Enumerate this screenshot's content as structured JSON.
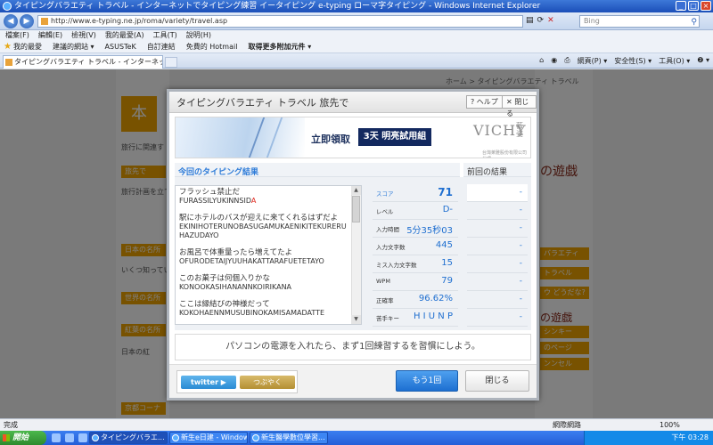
{
  "window": {
    "title": "タイピングバラエティ トラベル - インターネットでタイピング練習 イータイピング e-typing ローマ字タイピング - Windows Internet Explorer",
    "min": "_",
    "max": "□",
    "close": "×"
  },
  "browser": {
    "back": "◀",
    "forward": "▶",
    "url": "http://www.e-typing.ne.jp/roma/variety/travel.asp",
    "search_placeholder": "Bing",
    "menu": [
      "檔案(F)",
      "編輯(E)",
      "檢視(V)",
      "我的最愛(A)",
      "工具(T)",
      "說明(H)"
    ],
    "favorites": [
      "我的最愛",
      "建議的網站 ▾",
      "ASUSTeK",
      "自訂連結",
      "免費的 Hotmail",
      "取得更多附加元件 ▾"
    ],
    "tab_title": "タイピングバラエティ トラベル - インターネッ...",
    "commands": [
      "網頁(P) ▾",
      "安全性(S) ▾",
      "工具(O) ▾",
      "❷ ▾"
    ],
    "status_text": "完成",
    "zone": "網際網路",
    "zoom": "100%"
  },
  "background_page": {
    "breadcrumb": "ホーム > タイピングバラエティ トラベル",
    "logo_glyph": "本",
    "left_lines": [
      "旅行に関連す",
      "旅先で",
      "旅行計画を立て",
      "日本の名所",
      "いくつ知ってい",
      "世界の名所",
      "紅葉の名所",
      "日本の紅",
      "京都コーナー"
    ],
    "right_lines": [
      "の遊戯",
      "バラエティ",
      "トラベル",
      "ウ どうだな?",
      "の遊戯",
      "シンキー",
      "のページ",
      "ンンセル"
    ]
  },
  "modal": {
    "title": "タイピングバラエティ トラベル 旅先で",
    "help_label": "? ヘルプ",
    "close_label": "✕ 閉じる"
  },
  "ad": {
    "cta": "立即領取",
    "trial": "3天 明亮試用組",
    "brand": "VICHY",
    "brand_sub": "薇姿",
    "fine_print": "台灣萊雅股份有限公司代理"
  },
  "results": {
    "header": "今回のタイピング結果",
    "prev_header": "前回の結果",
    "words": [
      {
        "jp": "フラッシュ禁止だ",
        "ro": "FURASSILYUKINNSID",
        "miss": "A"
      },
      {
        "jp": "駅にホテルのバスが迎えに来てくれるはずだよ",
        "ro": "EKINIHOTERUNOBASUGAMUKAENIKITEKURERUHAZUDAYO",
        "miss": ""
      },
      {
        "jp": "お風呂で体重量ったら増えてたよ",
        "ro": "OFURODETAIJYUUHAKATTARAFUETETAYO",
        "miss": ""
      },
      {
        "jp": "このお菓子は何個入りかな",
        "ro": "KONOOKASIHANANNKOIRIKANA",
        "miss": ""
      },
      {
        "jp": "ここは縁結びの神様だって",
        "ro": "KOKOHAENNMUSUBINOKAMISAMADATTE",
        "miss": ""
      }
    ],
    "stats": [
      {
        "label": "スコア",
        "value": "71"
      },
      {
        "label": "レベル",
        "value": "D-"
      },
      {
        "label": "入力時間",
        "value": "5分35秒03"
      },
      {
        "label": "入力文字数",
        "value": "445"
      },
      {
        "label": "ミス入力文字数",
        "value": "15"
      },
      {
        "label": "WPM",
        "value": "79"
      },
      {
        "label": "正確率",
        "value": "96.62%"
      },
      {
        "label": "苦手キー",
        "value": "H I U N P"
      }
    ],
    "prev_values": [
      "-",
      "-",
      "-",
      "-",
      "-",
      "-",
      "-",
      "-"
    ]
  },
  "message": "パソコンの電源を入れたら、まず1回練習するを習慣にしよう。",
  "footer": {
    "twitter": "twitter ▶",
    "tsubuyaku": "つぶやく",
    "retry": "もう1回",
    "close": "閉じる"
  },
  "taskbar": {
    "start": "開始",
    "tasks": [
      "タイピングバラエ...",
      "新生e日建 - Windows...",
      "新生醫學數位學習..."
    ],
    "clock": "下午 03:28"
  }
}
